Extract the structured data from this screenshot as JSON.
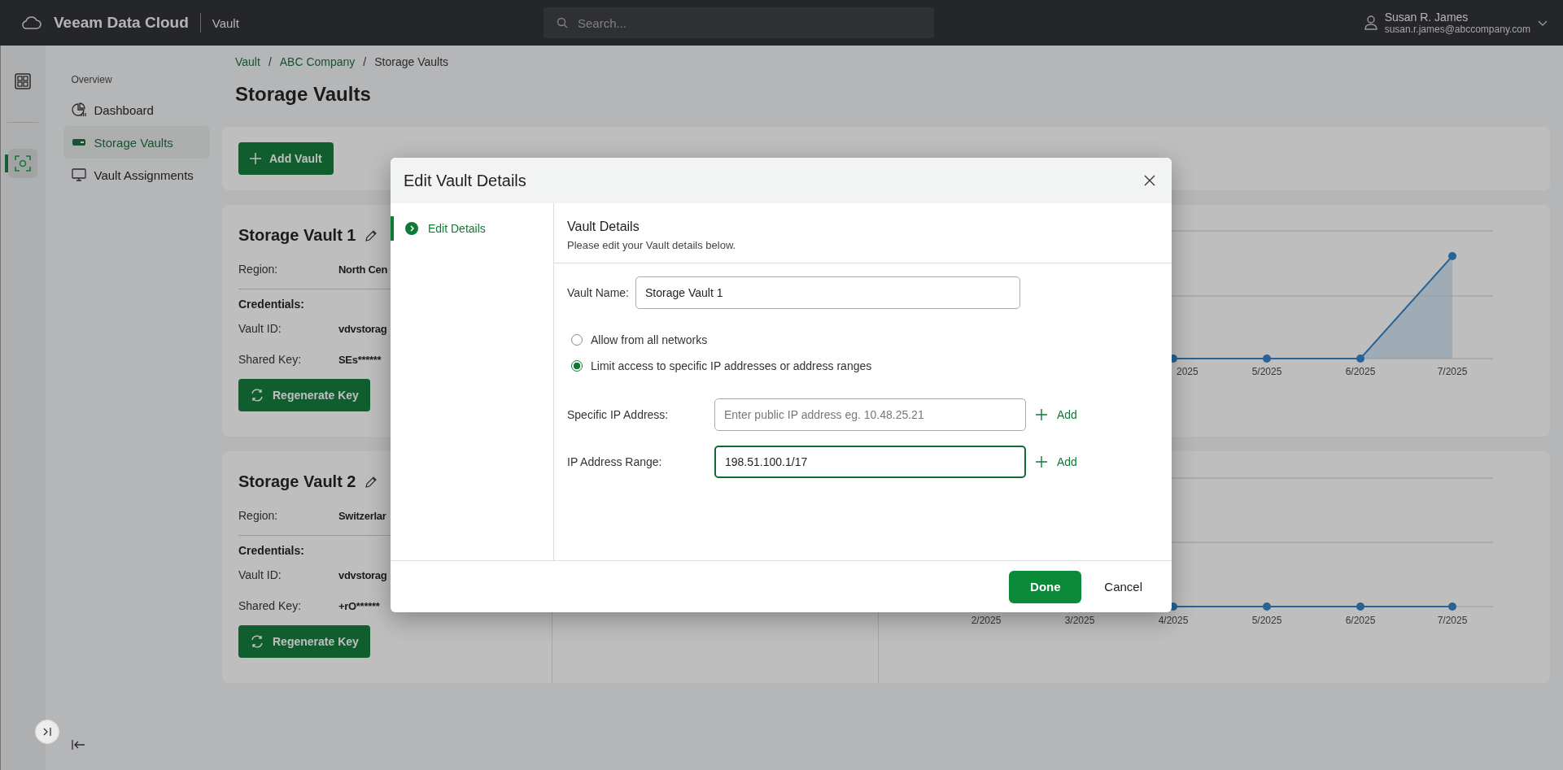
{
  "top_bar": {
    "product": "Veeam Data Cloud",
    "section": "Vault",
    "search": {
      "placeholder": "Search..."
    },
    "user": {
      "name": "Susan R. James",
      "email": "susan.r.james@abccompany.com"
    }
  },
  "rail": [
    {
      "kind": "dashboard",
      "selected": false
    },
    {
      "kind": "vault",
      "selected": true
    }
  ],
  "nav": {
    "heading": "Overview",
    "items": [
      {
        "label": "Dashboard",
        "kind": "dashboard",
        "selected": false
      },
      {
        "label": "Storage Vaults",
        "kind": "vault",
        "selected": true
      },
      {
        "label": "Vault Assignments",
        "kind": "monitor",
        "selected": false
      }
    ]
  },
  "breadcrumb": [
    {
      "kind": "link",
      "text": "Vault"
    },
    {
      "kind": "separator",
      "text": "/"
    },
    {
      "kind": "link",
      "text": "ABC Company"
    },
    {
      "kind": "separator",
      "text": "/"
    },
    {
      "kind": "current",
      "text": "Storage Vaults"
    }
  ],
  "page_title": "Storage Vaults",
  "add_button": "Add Vault",
  "vaults": [
    {
      "name": "Storage Vault 1",
      "region_label": "Region:",
      "region": "North Cen",
      "credentials_label": "Credentials:",
      "vault_id_label": "Vault ID:",
      "vault_id": "vdvstorag",
      "shared_key_label": "Shared Key:",
      "shared_key": "SEs******",
      "button": "Regenerate Key",
      "chart": {
        "kind": "spike",
        "x_labels": [
          "2025",
          "5/2025",
          "6/2025",
          "7/2025"
        ]
      }
    },
    {
      "name": "Storage Vault 2",
      "region_label": "Region:",
      "region": "Switzerlar",
      "credentials_label": "Credentials:",
      "vault_id_label": "Vault ID:",
      "vault_id": "vdvstorag",
      "shared_key_label": "Shared Key:",
      "shared_key": "+rO******",
      "button": "Regenerate Key",
      "chart": {
        "kind": "flat",
        "x_labels": [
          "2/2025",
          "3/2025",
          "4/2025",
          "5/2025",
          "6/2025",
          "7/2025"
        ]
      }
    }
  ],
  "dialog": {
    "title": "Edit Vault Details",
    "steps": [
      {
        "label": "Edit Details",
        "selected": true
      }
    ],
    "section_title": "Vault Details",
    "section_subtitle": "Please edit your Vault details below.",
    "vault_name": {
      "label": "Vault Name:",
      "value": "Storage Vault 1"
    },
    "access_options": [
      {
        "label": "Allow from all networks",
        "selected": false
      },
      {
        "label": "Limit access to specific IP addresses or address ranges",
        "selected": true
      }
    ],
    "ip_fields": [
      {
        "label": "Specific IP Address:",
        "placeholder": "Enter public IP address eg. 10.48.25.21",
        "focused": false,
        "add": "Add"
      },
      {
        "label": "IP Address Range:",
        "value": "198.51.100.1/17",
        "focused": true,
        "add": "Add"
      }
    ],
    "buttons": {
      "primary": "Done",
      "secondary": "Cancel"
    }
  }
}
